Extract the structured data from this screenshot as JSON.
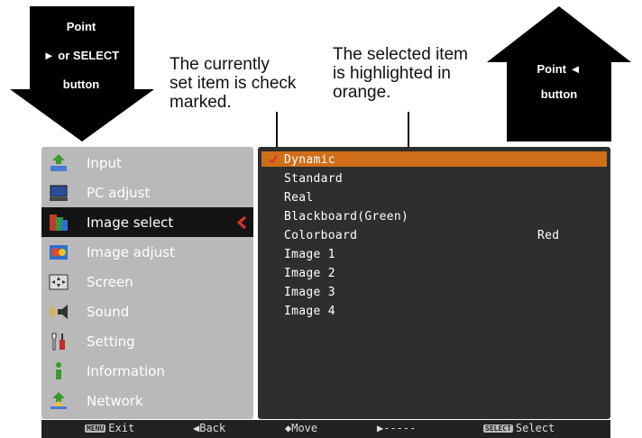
{
  "arrows": {
    "down": {
      "line1": "Point",
      "line2": "► or SELECT",
      "line3": "button"
    },
    "up": {
      "line1": "Point ◄",
      "line2": "button"
    }
  },
  "callouts": {
    "left": [
      "The currently",
      "set item is check",
      "marked."
    ],
    "right": [
      "The selected item",
      "is highlighted in",
      "orange."
    ]
  },
  "menu": {
    "items": [
      {
        "label": "Input",
        "icon": "input-icon"
      },
      {
        "label": "PC adjust",
        "icon": "pc-adjust-icon"
      },
      {
        "label": "Image select",
        "icon": "image-select-icon"
      },
      {
        "label": "Image adjust",
        "icon": "image-adjust-icon"
      },
      {
        "label": "Screen",
        "icon": "screen-icon"
      },
      {
        "label": "Sound",
        "icon": "sound-icon"
      },
      {
        "label": "Setting",
        "icon": "setting-icon"
      },
      {
        "label": "Information",
        "icon": "information-icon"
      },
      {
        "label": "Network",
        "icon": "network-icon"
      }
    ],
    "selected": "Image select"
  },
  "options": {
    "items": [
      "Dynamic",
      "Standard",
      "Real",
      "Blackboard(Green)",
      "Colorboard",
      "Image 1",
      "Image 2",
      "Image 3",
      "Image 4"
    ],
    "checked": "Dynamic",
    "colorboard_value": "Red",
    "highlight_color": "#d06e1a"
  },
  "bottom_bar": {
    "exit_key": "MENU",
    "exit": "Exit",
    "back": "◀Back",
    "move": "◆Move",
    "right": "▶-----",
    "select_key": "SELECT",
    "select": "Select"
  }
}
